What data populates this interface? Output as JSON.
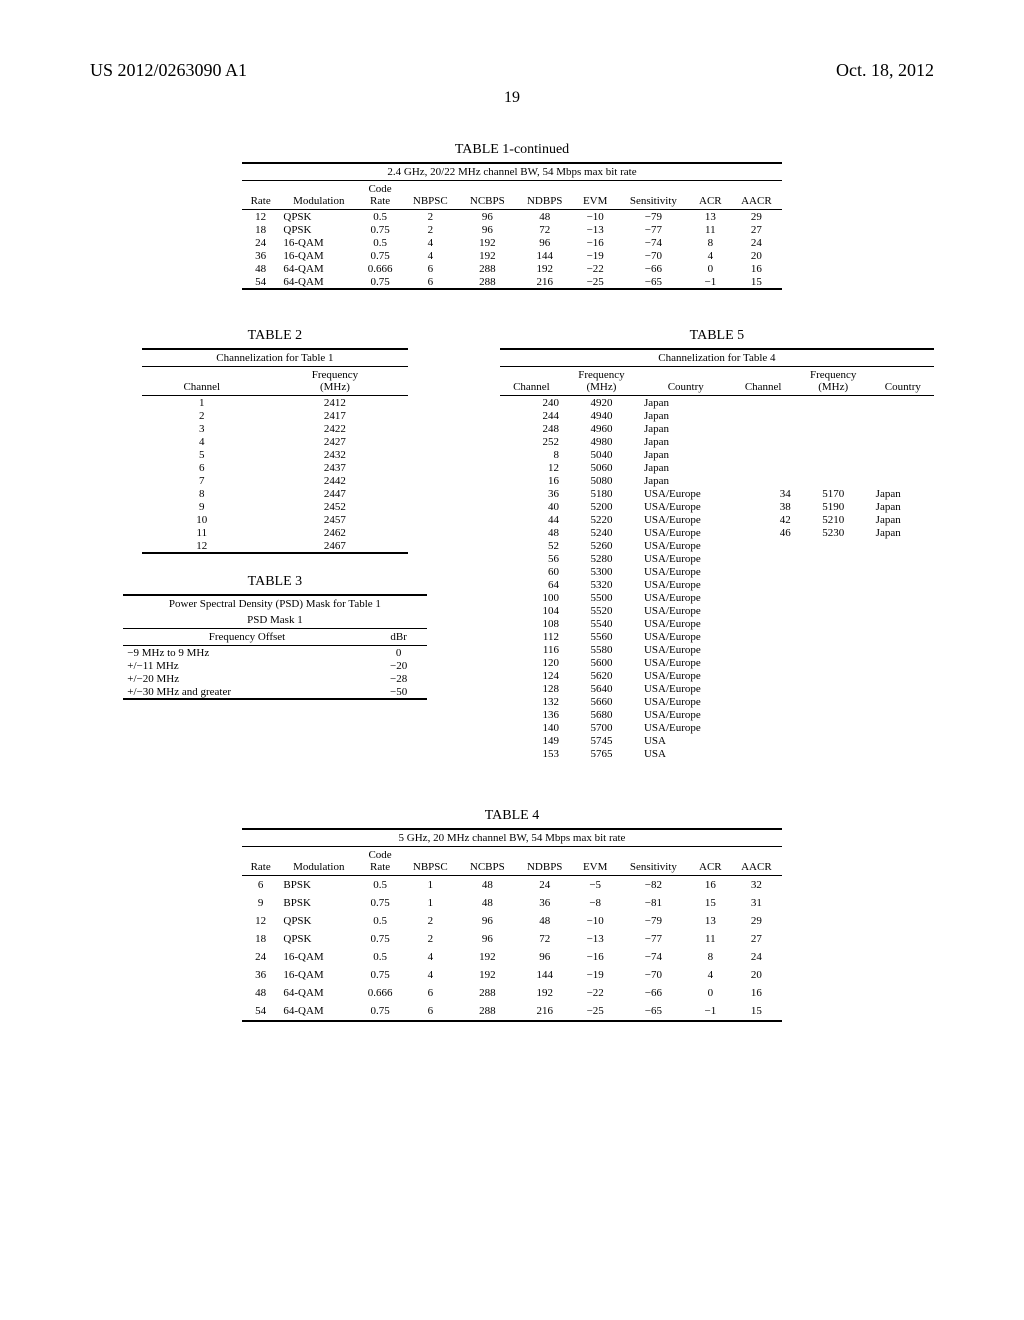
{
  "header": {
    "left": "US 2012/0263090 A1",
    "right": "Oct. 18, 2012",
    "page": "19"
  },
  "table1": {
    "title": "TABLE 1-continued",
    "subtitle": "2.4 GHz, 20/22 MHz channel BW, 54 Mbps max bit rate",
    "columns": [
      "Rate",
      "Modulation",
      "Code Rate",
      "NBPSC",
      "NCBPS",
      "NDBPS",
      "EVM",
      "Sensitivity",
      "ACR",
      "AACR"
    ],
    "rows": [
      [
        "12",
        "QPSK",
        "0.5",
        "2",
        "96",
        "48",
        "−10",
        "−79",
        "13",
        "29"
      ],
      [
        "18",
        "QPSK",
        "0.75",
        "2",
        "96",
        "72",
        "−13",
        "−77",
        "11",
        "27"
      ],
      [
        "24",
        "16-QAM",
        "0.5",
        "4",
        "192",
        "96",
        "−16",
        "−74",
        "8",
        "24"
      ],
      [
        "36",
        "16-QAM",
        "0.75",
        "4",
        "192",
        "144",
        "−19",
        "−70",
        "4",
        "20"
      ],
      [
        "48",
        "64-QAM",
        "0.666",
        "6",
        "288",
        "192",
        "−22",
        "−66",
        "0",
        "16"
      ],
      [
        "54",
        "64-QAM",
        "0.75",
        "6",
        "288",
        "216",
        "−25",
        "−65",
        "−1",
        "15"
      ]
    ]
  },
  "table2": {
    "title": "TABLE 2",
    "subtitle": "Channelization for Table 1",
    "columns": [
      "Channel",
      "Frequency (MHz)"
    ],
    "rows": [
      [
        "1",
        "2412"
      ],
      [
        "2",
        "2417"
      ],
      [
        "3",
        "2422"
      ],
      [
        "4",
        "2427"
      ],
      [
        "5",
        "2432"
      ],
      [
        "6",
        "2437"
      ],
      [
        "7",
        "2442"
      ],
      [
        "8",
        "2447"
      ],
      [
        "9",
        "2452"
      ],
      [
        "10",
        "2457"
      ],
      [
        "11",
        "2462"
      ],
      [
        "12",
        "2467"
      ]
    ]
  },
  "table3": {
    "title": "TABLE 3",
    "subtitle": "Power Spectral Density (PSD) Mask for Table 1",
    "subtitle2": "PSD Mask 1",
    "columns": [
      "Frequency Offset",
      "dBr"
    ],
    "rows": [
      [
        "−9 MHz to 9 MHz",
        "0"
      ],
      [
        "+/−11 MHz",
        "−20"
      ],
      [
        "+/−20 MHz",
        "−28"
      ],
      [
        "+/−30 MHz and greater",
        "−50"
      ]
    ]
  },
  "table5": {
    "title": "TABLE 5",
    "subtitle": "Channelization for Table 4",
    "columns": [
      "Channel",
      "Frequency (MHz)",
      "Country",
      "Channel",
      "Frequency (MHz)",
      "Country"
    ],
    "rows": [
      [
        "240",
        "4920",
        "Japan",
        "",
        "",
        ""
      ],
      [
        "244",
        "4940",
        "Japan",
        "",
        "",
        ""
      ],
      [
        "248",
        "4960",
        "Japan",
        "",
        "",
        ""
      ],
      [
        "252",
        "4980",
        "Japan",
        "",
        "",
        ""
      ],
      [
        "8",
        "5040",
        "Japan",
        "",
        "",
        ""
      ],
      [
        "12",
        "5060",
        "Japan",
        "",
        "",
        ""
      ],
      [
        "16",
        "5080",
        "Japan",
        "",
        "",
        ""
      ],
      [
        "36",
        "5180",
        "USA/Europe",
        "34",
        "5170",
        "Japan"
      ],
      [
        "40",
        "5200",
        "USA/Europe",
        "38",
        "5190",
        "Japan"
      ],
      [
        "44",
        "5220",
        "USA/Europe",
        "42",
        "5210",
        "Japan"
      ],
      [
        "48",
        "5240",
        "USA/Europe",
        "46",
        "5230",
        "Japan"
      ],
      [
        "52",
        "5260",
        "USA/Europe",
        "",
        "",
        ""
      ],
      [
        "56",
        "5280",
        "USA/Europe",
        "",
        "",
        ""
      ],
      [
        "60",
        "5300",
        "USA/Europe",
        "",
        "",
        ""
      ],
      [
        "64",
        "5320",
        "USA/Europe",
        "",
        "",
        ""
      ],
      [
        "100",
        "5500",
        "USA/Europe",
        "",
        "",
        ""
      ],
      [
        "104",
        "5520",
        "USA/Europe",
        "",
        "",
        ""
      ],
      [
        "108",
        "5540",
        "USA/Europe",
        "",
        "",
        ""
      ],
      [
        "112",
        "5560",
        "USA/Europe",
        "",
        "",
        ""
      ],
      [
        "116",
        "5580",
        "USA/Europe",
        "",
        "",
        ""
      ],
      [
        "120",
        "5600",
        "USA/Europe",
        "",
        "",
        ""
      ],
      [
        "124",
        "5620",
        "USA/Europe",
        "",
        "",
        ""
      ],
      [
        "128",
        "5640",
        "USA/Europe",
        "",
        "",
        ""
      ],
      [
        "132",
        "5660",
        "USA/Europe",
        "",
        "",
        ""
      ],
      [
        "136",
        "5680",
        "USA/Europe",
        "",
        "",
        ""
      ],
      [
        "140",
        "5700",
        "USA/Europe",
        "",
        "",
        ""
      ],
      [
        "149",
        "5745",
        "USA",
        "",
        "",
        ""
      ],
      [
        "153",
        "5765",
        "USA",
        "",
        "",
        ""
      ]
    ]
  },
  "table4": {
    "title": "TABLE 4",
    "subtitle": "5 GHz, 20 MHz channel BW, 54 Mbps max bit rate",
    "columns": [
      "Rate",
      "Modulation",
      "Code Rate",
      "NBPSC",
      "NCBPS",
      "NDBPS",
      "EVM",
      "Sensitivity",
      "ACR",
      "AACR"
    ],
    "rows": [
      [
        "6",
        "BPSK",
        "0.5",
        "1",
        "48",
        "24",
        "−5",
        "−82",
        "16",
        "32"
      ],
      [
        "9",
        "BPSK",
        "0.75",
        "1",
        "48",
        "36",
        "−8",
        "−81",
        "15",
        "31"
      ],
      [
        "12",
        "QPSK",
        "0.5",
        "2",
        "96",
        "48",
        "−10",
        "−79",
        "13",
        "29"
      ],
      [
        "18",
        "QPSK",
        "0.75",
        "2",
        "96",
        "72",
        "−13",
        "−77",
        "11",
        "27"
      ],
      [
        "24",
        "16-QAM",
        "0.5",
        "4",
        "192",
        "96",
        "−16",
        "−74",
        "8",
        "24"
      ],
      [
        "36",
        "16-QAM",
        "0.75",
        "4",
        "192",
        "144",
        "−19",
        "−70",
        "4",
        "20"
      ],
      [
        "48",
        "64-QAM",
        "0.666",
        "6",
        "288",
        "192",
        "−22",
        "−66",
        "0",
        "16"
      ],
      [
        "54",
        "64-QAM",
        "0.75",
        "6",
        "288",
        "216",
        "−25",
        "−65",
        "−1",
        "15"
      ]
    ]
  }
}
